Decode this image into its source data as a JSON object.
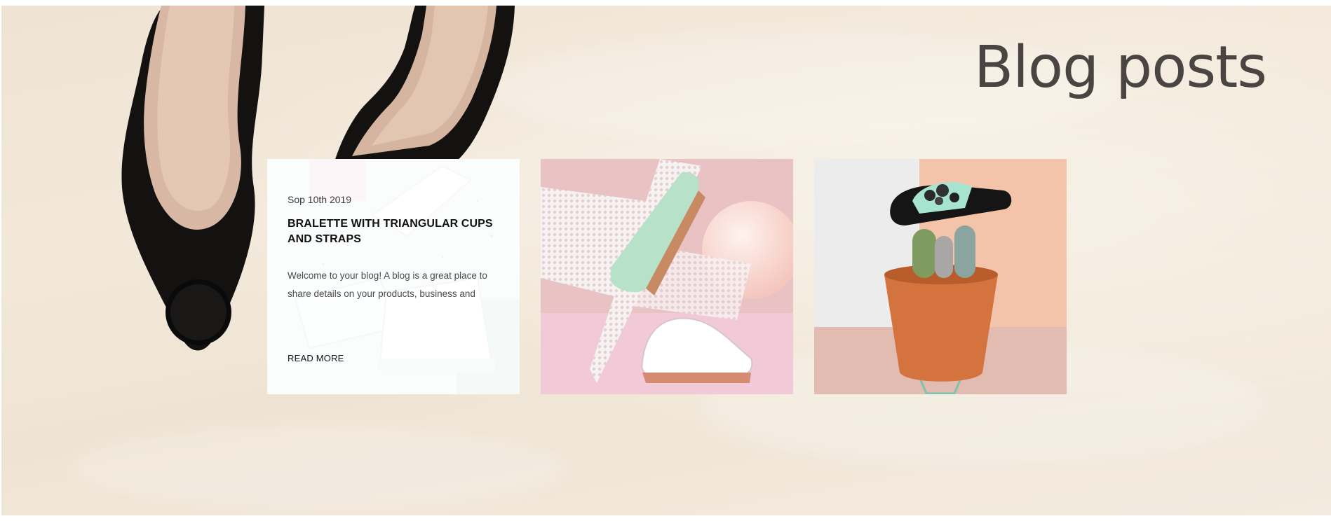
{
  "section": {
    "title": "Blog posts"
  },
  "posts": [
    {
      "date": "Sop 10th 2019",
      "title": "BRALETTE WITH TRIANGULAR CUPS AND STRAPS",
      "excerpt": "Welcome to your blog! A blog is a great place to share details on your products, business and",
      "read_more": "READ MORE",
      "image": "white-platform-shoes-image"
    },
    {
      "image": "mint-perforated-sneakers-image"
    },
    {
      "image": "slide-sandal-on-cactus-image"
    }
  ],
  "colors": {
    "background": "#efe4d4",
    "title": "#4a4542",
    "card_overlay": "#ffffff"
  }
}
